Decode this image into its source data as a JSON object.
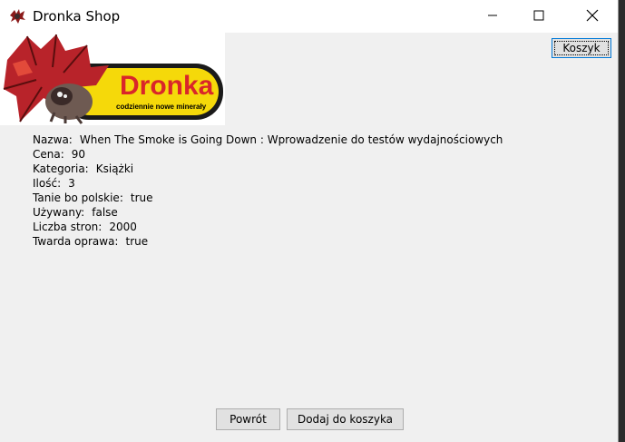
{
  "window": {
    "title": "Dronka Shop"
  },
  "logo": {
    "brand": "Dronka",
    "tagline": "codziennie nowe minerały"
  },
  "header": {
    "cart_label": "Koszyk"
  },
  "product": {
    "fields": [
      {
        "label": "Nazwa:",
        "value": "When The Smoke is Going Down : Wprowadzenie do testów wydajnościowych"
      },
      {
        "label": "Cena:",
        "value": "90"
      },
      {
        "label": "Kategoria:",
        "value": "Książki"
      },
      {
        "label": "Ilość:",
        "value": "3"
      },
      {
        "label": "Tanie bo polskie:",
        "value": "true"
      },
      {
        "label": "Używany:",
        "value": "false"
      },
      {
        "label": "Liczba stron:",
        "value": "2000"
      },
      {
        "label": "Twarda oprawa:",
        "value": "true"
      }
    ]
  },
  "footer": {
    "back_label": "Powrót",
    "add_label": "Dodaj do koszyka"
  },
  "colors": {
    "accent": "#0078d7",
    "logo_yellow": "#f5d90a",
    "logo_red": "#d9262a"
  }
}
